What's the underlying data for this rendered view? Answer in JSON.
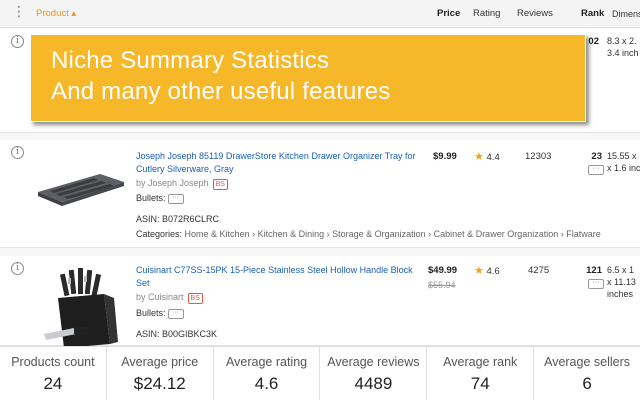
{
  "header": {
    "menu_icon": "vertical-dots-icon",
    "product": "Product ▴",
    "price": "Price",
    "rating": "Rating",
    "reviews": "Reviews",
    "rank": "Rank",
    "dimensions": "Dimens"
  },
  "banner": {
    "line1": "Niche Summary Statistics",
    "line2": "And many other useful features"
  },
  "rows": [
    {
      "rank": "02",
      "dimensions_line1": "8.3 x 2.",
      "dimensions_line2": "3.4 inch"
    },
    {
      "title": "Joseph Joseph 85119 DrawerStore Kitchen Drawer Organizer Tray for Cutlery Silverware, Gray",
      "byline": "by Joseph Joseph",
      "badge": "BS",
      "bullets_label": "Bullets:",
      "more": "···",
      "asin": "ASIN: B072R6CLRC",
      "categories_label": "Categories:",
      "categories_path": "Home & Kitchen › Kitchen & Dining › Storage & Organization › Cabinet & Drawer Organization › Flatware",
      "price": "$9.99",
      "star": "★",
      "rating": "4.4",
      "reviews": "12303",
      "rank": "23",
      "dimensions_line1": "15.55 x",
      "dimensions_line2": "x 1.6 inc"
    },
    {
      "title": "Cuisinart C77SS-15PK 15-Piece Stainless Steel Hollow Handle Block Set",
      "byline": "by Cuisinart",
      "badge": "BS",
      "bullets_label": "Bullets:",
      "more": "···",
      "asin": "ASIN: B00GIBKC3K",
      "price": "$49.99",
      "old_price": "$55.94",
      "star": "★",
      "rating": "4.6",
      "reviews": "4275",
      "rank": "121",
      "dimensions_line1": "6.5 x 1",
      "dimensions_line2": "x 11.13",
      "dimensions_line3": "inches"
    }
  ],
  "stats": [
    {
      "label": "Products count",
      "value": "24"
    },
    {
      "label": "Average price",
      "value": "$24.12"
    },
    {
      "label": "Average rating",
      "value": "4.6"
    },
    {
      "label": "Average reviews",
      "value": "4489"
    },
    {
      "label": "Average rank",
      "value": "74"
    },
    {
      "label": "Average sellers",
      "value": "6"
    }
  ],
  "colors": {
    "banner": "#f6b829",
    "link": "#1a5fb4",
    "sort_accent": "#e6961e",
    "star": "#f0a418",
    "badge": "#e05a4a"
  }
}
